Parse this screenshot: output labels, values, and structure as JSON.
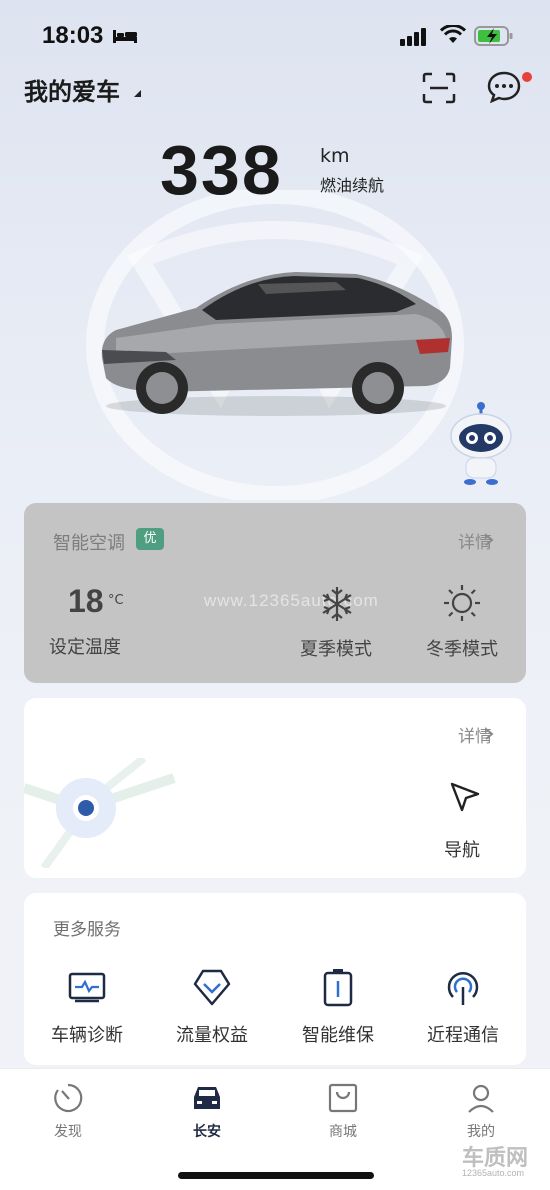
{
  "status_bar": {
    "time": "18:03"
  },
  "header": {
    "title": "我的爱车"
  },
  "vehicle": {
    "range_value": "338",
    "range_unit": "km",
    "range_label": "燃油续航"
  },
  "ac_card": {
    "title": "智能空调",
    "badge": "优",
    "detail_label": "详情",
    "temperature": "18",
    "temperature_unit": "°C",
    "temperature_label": "设定温度",
    "summer_label": "夏季模式",
    "winter_label": "冬季模式",
    "watermark": "www.12365auto.com"
  },
  "nav_card": {
    "detail_label": "详情",
    "navigate_label": "导航"
  },
  "services": {
    "title": "更多服务",
    "items": [
      {
        "label": "车辆诊断",
        "icon": "diagnostics-icon"
      },
      {
        "label": "流量权益",
        "icon": "data-plan-icon"
      },
      {
        "label": "智能维保",
        "icon": "maintenance-icon"
      },
      {
        "label": "近程通信",
        "icon": "near-field-icon"
      }
    ]
  },
  "tabs": [
    {
      "label": "发现",
      "icon": "discover-icon",
      "active": false
    },
    {
      "label": "长安",
      "icon": "car-icon",
      "active": true
    },
    {
      "label": "商城",
      "icon": "shop-icon",
      "active": false
    },
    {
      "label": "我的",
      "icon": "profile-icon",
      "active": false
    }
  ],
  "corner_watermark": {
    "logo": "车质网",
    "url": "12365auto.com"
  },
  "colors": {
    "badge_green": "#4f9e82",
    "notification_red": "#e8403a",
    "active_tab": "#1f2a44"
  }
}
